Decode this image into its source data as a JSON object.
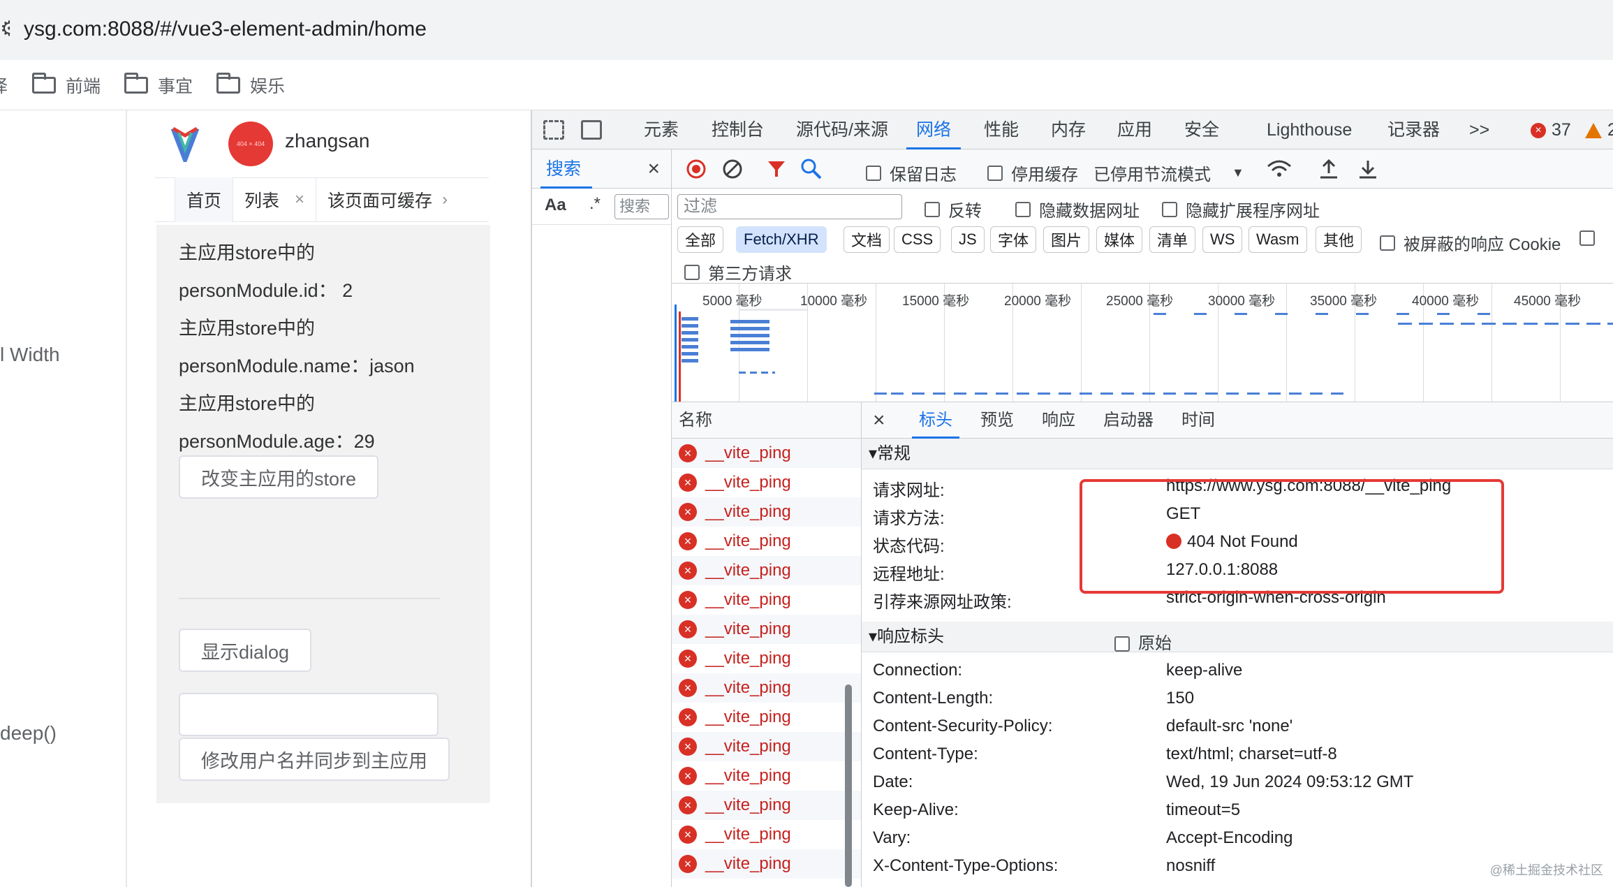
{
  "browser": {
    "url": "ysg.com:8088/#/vue3-element-admin/home",
    "bookmark_partial": "译",
    "bookmarks": [
      "前端",
      "事宜",
      "娱乐"
    ]
  },
  "left_page": {
    "fragment_width": "l Width",
    "fragment_deep": "deep()"
  },
  "app": {
    "avatar_text": "404 × 404",
    "username": "zhangsan",
    "tags": [
      {
        "label": "首页"
      },
      {
        "label": "列表",
        "close": "×"
      },
      {
        "label": "该页面可缓存",
        "chevron": "›"
      }
    ],
    "lines": [
      "主应用store中的",
      "personModule.id：  2",
      "主应用store中的",
      "personModule.name：jason",
      "主应用store中的",
      "personModule.age：29"
    ],
    "btn_change_store": "改变主应用的store",
    "btn_show_dialog": "显示dialog",
    "btn_modify_user": "修改用户名并同步到主应用"
  },
  "devtools": {
    "tabs": [
      "元素",
      "控制台",
      "源代码/来源",
      "网络",
      "性能",
      "内存",
      "应用",
      "安全",
      "Lighthouse",
      "记录器",
      ">>"
    ],
    "active_tab": "网络",
    "error_count": "37",
    "warn_count": "2",
    "search": {
      "title": "搜索",
      "close": "×",
      "aa": "Aa",
      "regex": ".*",
      "placeholder": "搜索"
    },
    "network": {
      "preserve_log": "保留日志",
      "disable_cache": "停用缓存",
      "throttle": "已停用节流模式",
      "filter_placeholder": "过滤",
      "invert": "反转",
      "hide_data_urls": "隐藏数据网址",
      "hide_extension_urls": "隐藏扩展程序网址",
      "types": [
        "全部",
        "Fetch/XHR",
        "文档",
        "CSS",
        "JS",
        "字体",
        "图片",
        "媒体",
        "清单",
        "WS",
        "Wasm",
        "其他"
      ],
      "selected_type": "Fetch/XHR",
      "blocked_cookies": "被屏蔽的响应 Cookie",
      "third_party": "第三方请求",
      "timeline_ticks": [
        "5000 毫秒",
        "10000 毫秒",
        "15000 毫秒",
        "20000 毫秒",
        "25000 毫秒",
        "30000 毫秒",
        "35000 毫秒",
        "40000 毫秒",
        "45000 毫秒"
      ],
      "name_header": "名称",
      "requests": [
        "__vite_ping",
        "__vite_ping",
        "__vite_ping",
        "__vite_ping",
        "__vite_ping",
        "__vite_ping",
        "__vite_ping",
        "__vite_ping",
        "__vite_ping",
        "__vite_ping",
        "__vite_ping",
        "__vite_ping",
        "__vite_ping",
        "__vite_ping",
        "__vite_ping"
      ],
      "detail_close": "×",
      "detail_tabs": [
        "标头",
        "预览",
        "响应",
        "启动器",
        "时间"
      ],
      "active_detail_tab": "标头",
      "general_title": "▾常规",
      "general": [
        {
          "k": "请求网址:",
          "v": "https://www.ysg.com:8088/__vite_ping"
        },
        {
          "k": "请求方法:",
          "v": "GET"
        },
        {
          "k": "状态代码:",
          "v": "404 Not Found"
        },
        {
          "k": "远程地址:",
          "v": "127.0.0.1:8088"
        },
        {
          "k": "引荐来源网址政策:",
          "v": "strict-origin-when-cross-origin"
        }
      ],
      "response_title": "▾响应标头",
      "raw": "原始",
      "response_headers": [
        {
          "k": "Connection:",
          "v": "keep-alive"
        },
        {
          "k": "Content-Length:",
          "v": "150"
        },
        {
          "k": "Content-Security-Policy:",
          "v": "default-src 'none'"
        },
        {
          "k": "Content-Type:",
          "v": "text/html; charset=utf-8"
        },
        {
          "k": "Date:",
          "v": "Wed, 19 Jun 2024 09:53:12 GMT"
        },
        {
          "k": "Keep-Alive:",
          "v": "timeout=5"
        },
        {
          "k": "Vary:",
          "v": "Accept-Encoding"
        },
        {
          "k": "X-Content-Type-Options:",
          "v": "nosniff"
        }
      ]
    }
  },
  "watermark": "@稀土掘金技术社区",
  "colors": {
    "accent": "#1a73e8",
    "error": "#d93025",
    "highlight_box": "#e53935"
  }
}
